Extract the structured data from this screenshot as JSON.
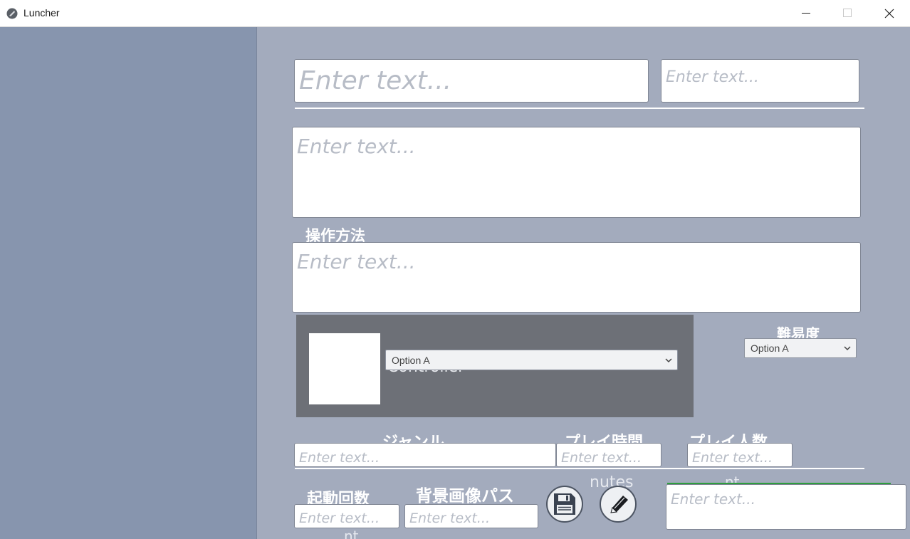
{
  "window": {
    "title": "Luncher",
    "icon": "app-logo-icon",
    "controls": [
      "minimize-icon",
      "maximize-icon",
      "close-icon"
    ]
  },
  "editor": {
    "title_input": {
      "placeholder": "Enter text..."
    },
    "subtitle_input": {
      "placeholder": "Enter text..."
    },
    "description_input": {
      "placeholder": "Enter text..."
    },
    "controls_label": "操作方法",
    "controls_input": {
      "placeholder": "Enter text..."
    },
    "controller_panel": {
      "ghost_label": "Controller",
      "select_value": "Option A"
    },
    "difficulty": {
      "label": "難易度",
      "select_value": "Option A"
    },
    "genre": {
      "label": "ジャンル",
      "placeholder": "Enter text..."
    },
    "play_time": {
      "label": "プレイ時間",
      "placeholder": "Enter text...",
      "ghost_unit": "nutes"
    },
    "players": {
      "label": "プレイ人数",
      "placeholder": "Enter text...",
      "ghost_unit": "nt"
    },
    "launch_count": {
      "label": "起動回数",
      "placeholder": "Enter text...",
      "ghost_unit": "nt"
    },
    "background_path": {
      "label": "背景画像パス",
      "placeholder": "Enter text..."
    },
    "save_button_icon": "floppy-disk-icon",
    "edit_button_icon": "pencil-icon",
    "notes_input": {
      "placeholder": "Enter text..."
    }
  },
  "colors": {
    "sidebar": "#8795ae",
    "main": "#a3abbd",
    "panel": "#6d7077",
    "accent_green": "#2e9e3e"
  }
}
